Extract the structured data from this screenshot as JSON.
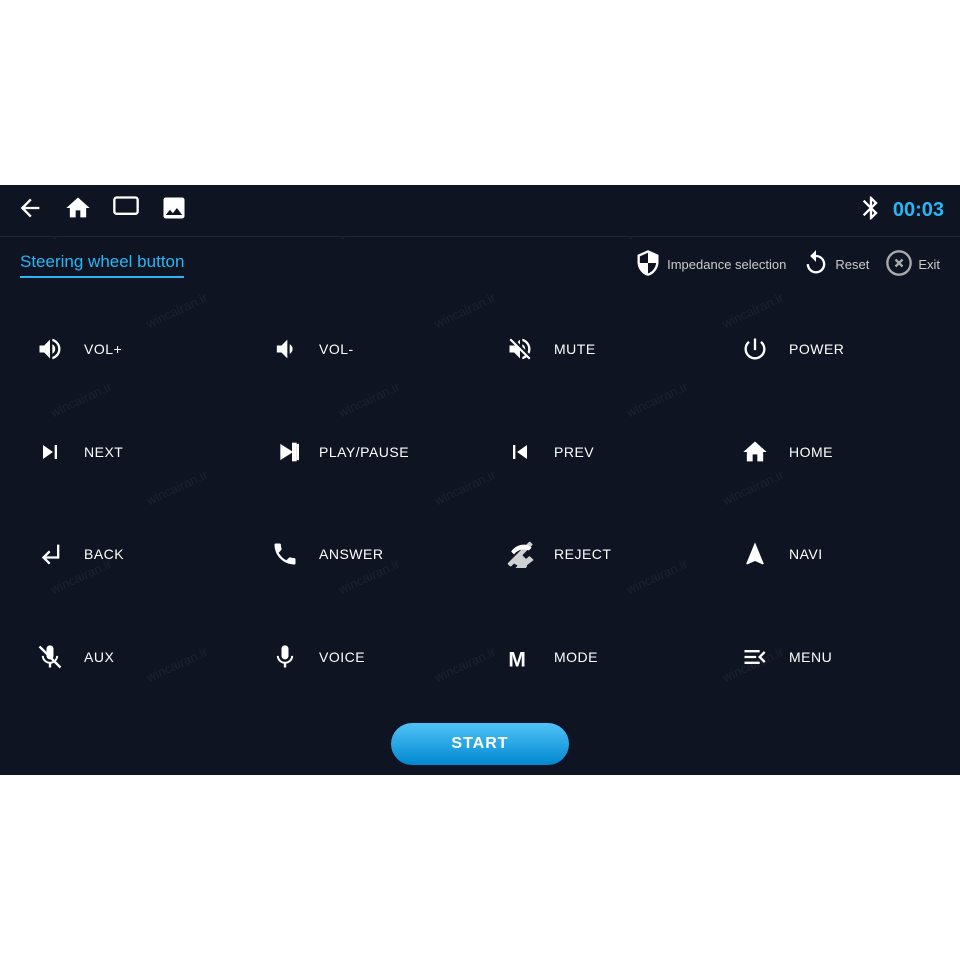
{
  "topbar": {
    "time": "00:03",
    "icons": [
      "back-icon",
      "home-icon",
      "window-icon",
      "image-icon",
      "bluetooth-icon"
    ]
  },
  "title": "Steering wheel button",
  "actions": [
    {
      "label": "Impedance selection",
      "icon": "shield-icon"
    },
    {
      "label": "Reset",
      "icon": "reset-icon"
    },
    {
      "label": "Exit",
      "icon": "exit-icon"
    }
  ],
  "buttons": [
    {
      "icon": "vol-up",
      "label": "VOL+"
    },
    {
      "icon": "vol-down",
      "label": "VOL-"
    },
    {
      "icon": "mute",
      "label": "MUTE"
    },
    {
      "icon": "power",
      "label": "POWER"
    },
    {
      "icon": "next",
      "label": "NEXT"
    },
    {
      "icon": "play-pause",
      "label": "PLAY/PAUSE"
    },
    {
      "icon": "prev",
      "label": "PREV"
    },
    {
      "icon": "home",
      "label": "HOME"
    },
    {
      "icon": "back",
      "label": "BACK"
    },
    {
      "icon": "answer",
      "label": "ANSWER"
    },
    {
      "icon": "reject",
      "label": "REJECT"
    },
    {
      "icon": "navi",
      "label": "NAVI"
    },
    {
      "icon": "aux",
      "label": "AUX"
    },
    {
      "icon": "voice",
      "label": "VOICE"
    },
    {
      "icon": "mode",
      "label": "MODE"
    },
    {
      "icon": "menu",
      "label": "MENU"
    }
  ],
  "start_label": "START",
  "watermark_text": "wincairan.ir"
}
